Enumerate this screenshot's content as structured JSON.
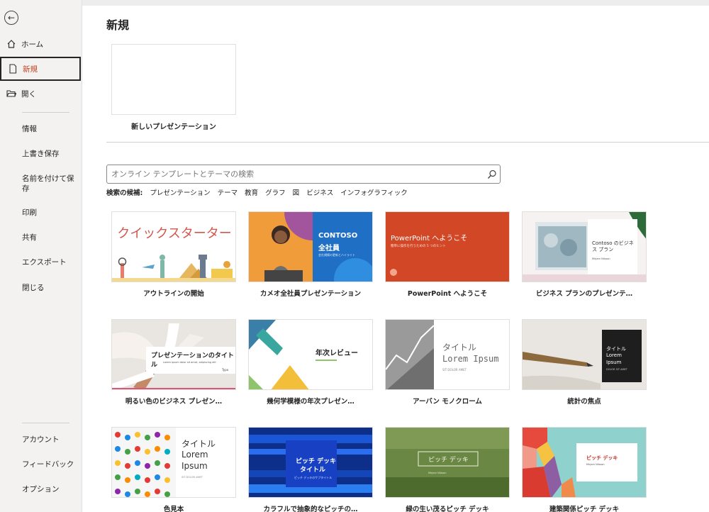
{
  "sidebar": {
    "home": "ホーム",
    "new": "新規",
    "open": "開く",
    "info": "情報",
    "save": "上書き保存",
    "saveas": "名前を付けて保存",
    "print": "印刷",
    "share": "共有",
    "export": "エクスポート",
    "close": "閉じる",
    "account": "アカウント",
    "feedback": "フィードバック",
    "options": "オプション"
  },
  "main": {
    "title": "新規",
    "blank_label": "新しいプレゼンテーション",
    "search_placeholder": "オンライン テンプレートとテーマの検索",
    "suggest_label": "検索の候補:",
    "suggestions": [
      "プレゼンテーション",
      "テーマ",
      "教育",
      "グラフ",
      "図",
      "ビジネス",
      "インフォグラフィック"
    ]
  },
  "templates": [
    {
      "label": "アウトラインの開始",
      "thumb_text": "クイックスターター"
    },
    {
      "label": "カメオ全社員プレゼンテーション",
      "thumb_text": "CONTOSO",
      "thumb_text2": "全社員",
      "thumb_text3": "会社規模の更新とハイライト"
    },
    {
      "label": "PowerPoint へようこそ",
      "thumb_text": "PowerPoint へようこそ",
      "thumb_text2": "簡単に操作を行うための 5 つのヒント"
    },
    {
      "label": "ビジネス プランのプレゼンテ…",
      "thumb_text": "Contoso のビジネス プラン",
      "thumb_text2": "Mirjam Nilsson"
    },
    {
      "label": "明るい色のビジネス プレゼン…",
      "thumb_text": "プレゼンテーションのタイトル",
      "thumb_text2": "Lorem ipsum dolor sit amet, adipiscing elit",
      "thumb_text3": "Typo"
    },
    {
      "label": "幾何学模様の年次プレゼン…",
      "thumb_text": "年次レビュー"
    },
    {
      "label": "アーバン モノクローム",
      "thumb_text": "タイトル",
      "thumb_text2": "Lorem Ipsum",
      "thumb_text3": "SIT DOLOR AMET"
    },
    {
      "label": "統計の焦点",
      "thumb_text": "タイトル",
      "thumb_text2": "Lorem",
      "thumb_text3": "Ipsum",
      "thumb_text4": "DOLOR SIT AMET"
    },
    {
      "label": "色見本",
      "thumb_text": "タイトル",
      "thumb_text2": "Lorem",
      "thumb_text3": "Ipsum",
      "thumb_text4": "SIT DOLOR AMET"
    },
    {
      "label": "カラフルで抽象的なピッチの…",
      "thumb_text": "ピッチ デッキ",
      "thumb_text2": "タイトル",
      "thumb_text3": "ピッチ デッキのサブタイトル"
    },
    {
      "label": "緑の生い茂るピッチ デッキ",
      "thumb_text": "ピッチ デッキ",
      "thumb_text2": "Mirjam Nilsson"
    },
    {
      "label": "建築関係ピッチ デッキ",
      "thumb_text": "ピッチ デッキ",
      "thumb_text2": "Mirjam Nilsson"
    }
  ]
}
